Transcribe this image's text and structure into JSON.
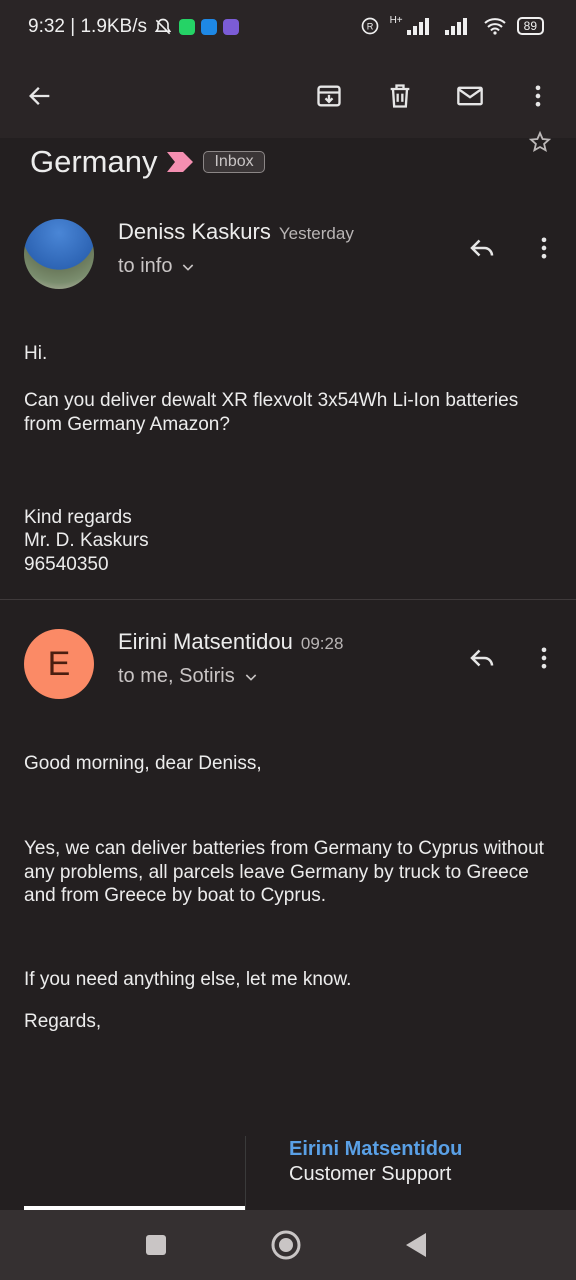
{
  "status_bar": {
    "time_speed": "9:32 | 1.9KB/s",
    "network_label": "H+",
    "battery": "89",
    "icons": [
      "mute-icon",
      "whatsapp-icon",
      "messages-icon",
      "viber-icon",
      "registered-icon",
      "signal-icon",
      "wifi-icon",
      "battery-icon"
    ]
  },
  "toolbar": {
    "icons": [
      "back-arrow-icon",
      "archive-icon",
      "delete-icon",
      "mark-unread-icon",
      "more-vert-icon"
    ]
  },
  "thread": {
    "subject": "Germany",
    "label": "Inbox"
  },
  "messages": [
    {
      "sender": "Deniss Kaskurs",
      "time": "Yesterday",
      "recipients": "to info",
      "body": {
        "greeting": "Hi.",
        "question": "Can you deliver dewalt XR flexvolt 3x54Wh Li-Ion batteries from Germany Amazon?",
        "closing": "Kind regards",
        "name": "Mr. D. Kaskurs",
        "phone": "96540350"
      }
    },
    {
      "sender": "Eirini Matsentidou",
      "avatar_letter": "E",
      "time": "09:28",
      "recipients": "to me, Sotiris",
      "body": {
        "greeting": "Good morning, dear Deniss,",
        "answer": "Yes, we can deliver batteries from Germany to Cyprus without any problems, all parcels leave Germany by truck to Greece and from Greece by boat to Cyprus.",
        "offer": "If you need anything else, let me know.",
        "closing": "Regards,"
      },
      "signature": {
        "name": "Eirini Matsentidou",
        "title": "Customer Support"
      }
    }
  ],
  "colors": {
    "background": "#231f20",
    "bar": "#2a2526",
    "accent_link": "#5aa0e6",
    "avatar_e": "#fb8a66",
    "important_marker": "#f48fb1"
  }
}
